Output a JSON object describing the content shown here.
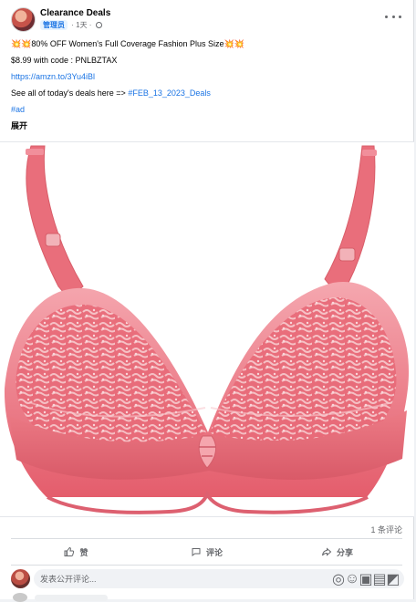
{
  "post": {
    "page_name": "Clearance Deals",
    "role": "管理员",
    "time": "· 1天 ·",
    "title_burst": "💥💥",
    "title_text": "80% OFF Women's Full Coverage Fashion Plus Size",
    "title_burst_end": "💥💥",
    "price_line": "$8.99 with code : PNLBZTAX",
    "link": "https://amzn.to/3Yu4iBl",
    "see_all_prefix": "See all of today's deals here => ",
    "see_all_tag": "#FEB_13_2023_Deals",
    "ad_tag": "#ad",
    "expand": "展开"
  },
  "icons": {
    "more": "more-horizontal-icon",
    "privacy": "globe-icon",
    "like": "thumb-up-icon",
    "comment": "speech-bubble-icon",
    "share": "share-arrow-icon",
    "sticker": "sticker-icon",
    "emoji": "emoji-icon",
    "camera": "camera-icon",
    "gif": "gif-icon",
    "avatar_sticker": "avatar-sticker-icon"
  },
  "engagement": {
    "comments": "1 条评论"
  },
  "actions": {
    "like": "赞",
    "comment": "评论",
    "share": "分享"
  },
  "composer": {
    "placeholder": "发表公开评论..."
  },
  "colors": {
    "link": "#1b74e4",
    "product_pink": "#e9717d"
  }
}
